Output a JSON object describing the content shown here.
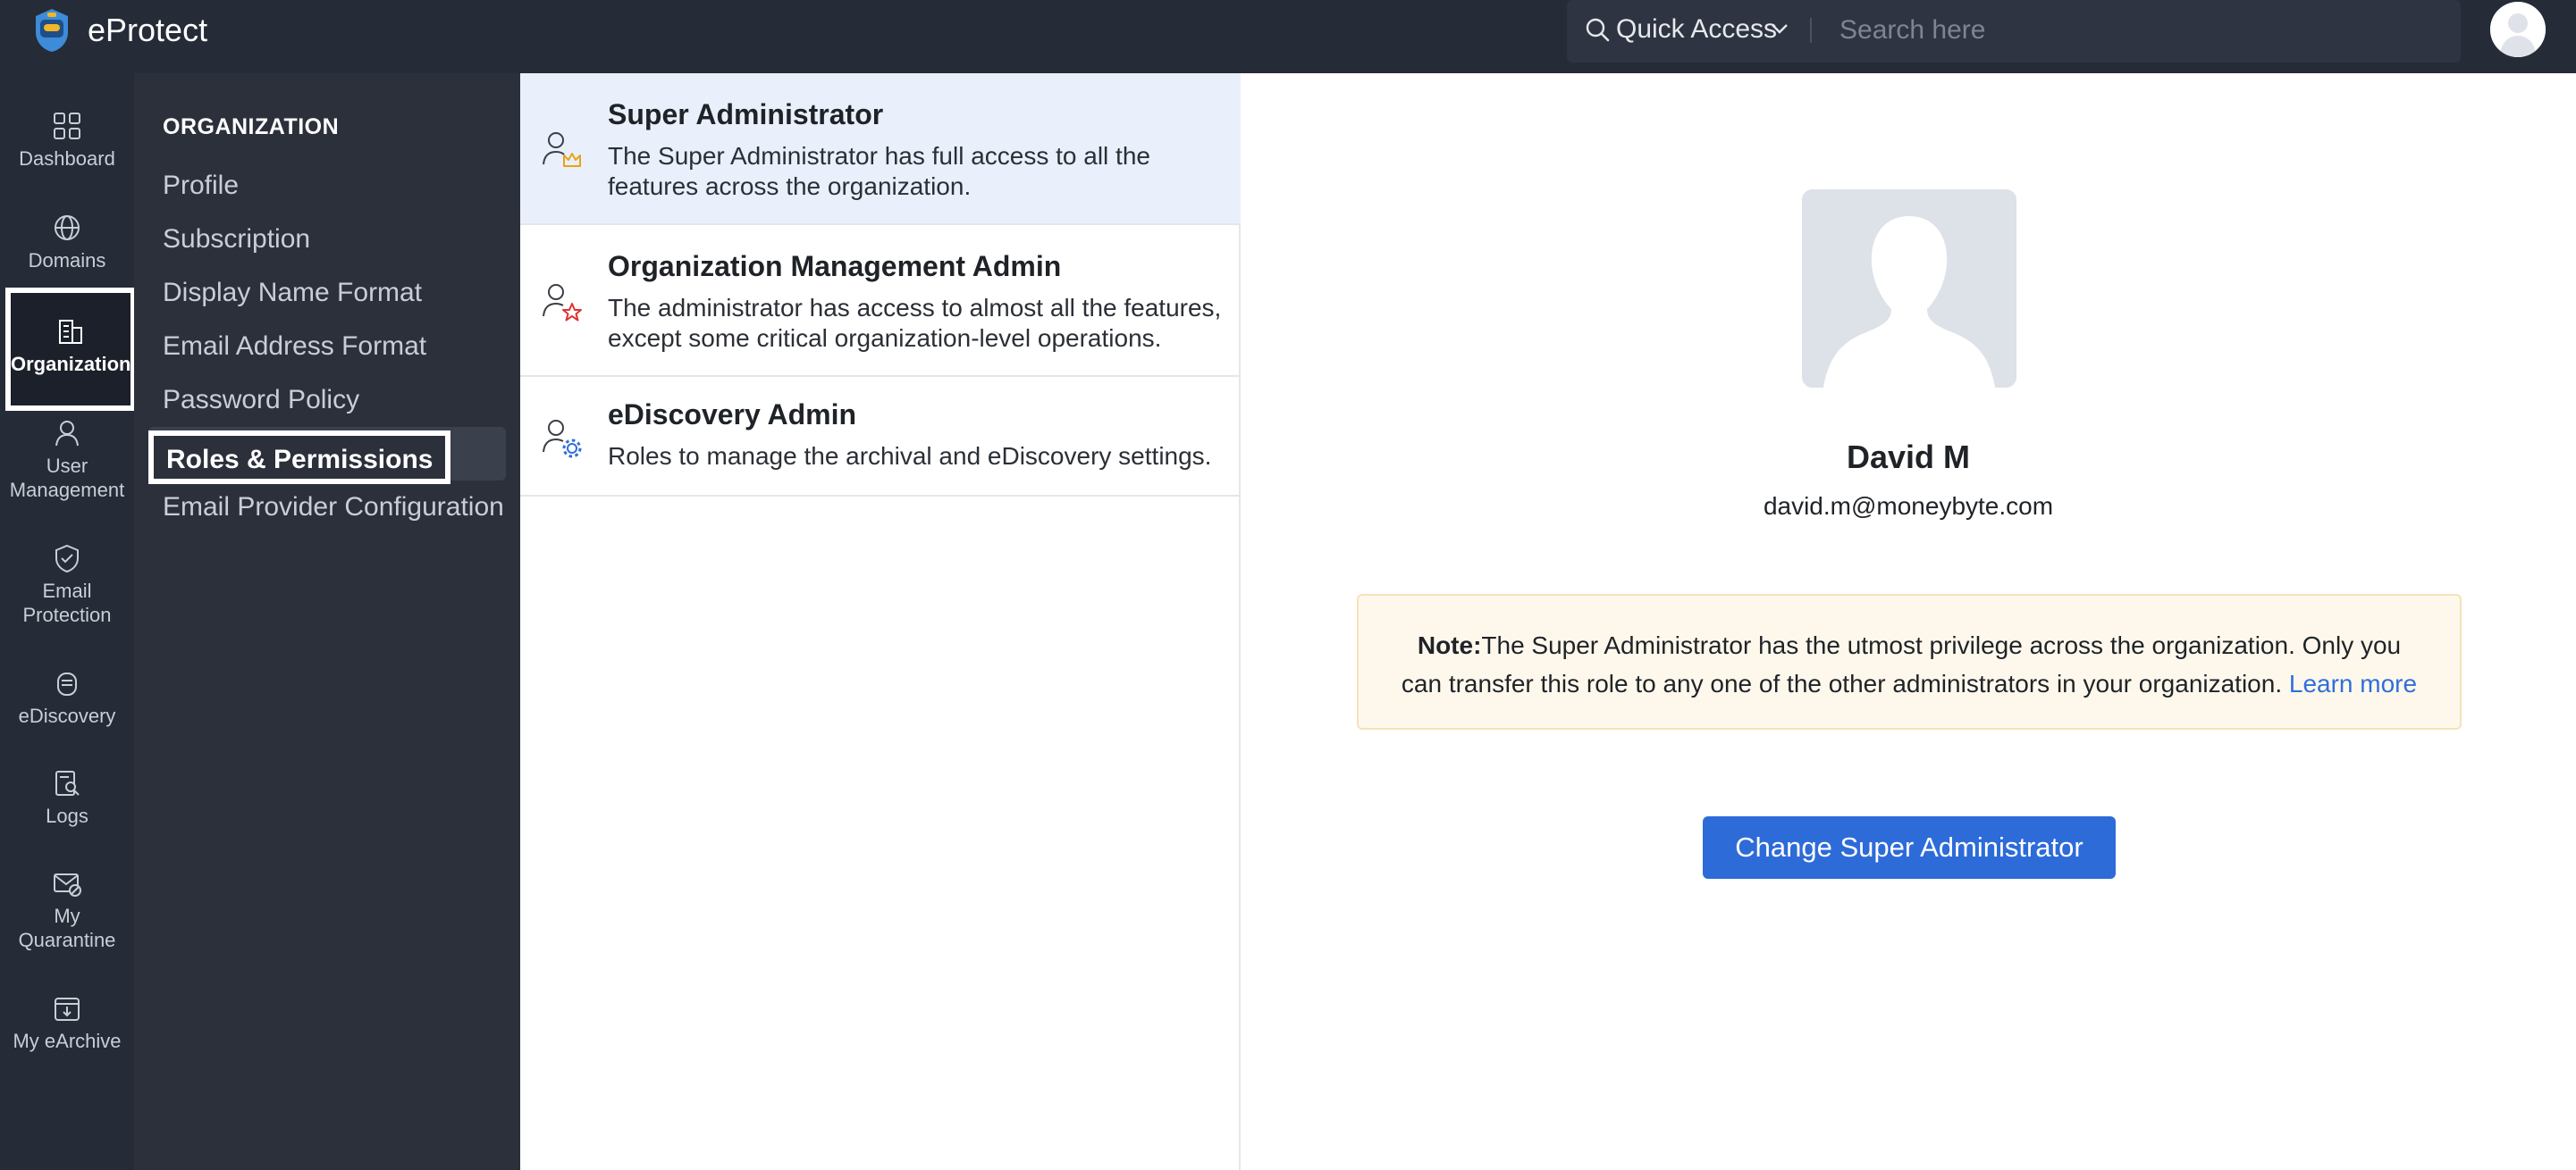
{
  "app": {
    "name": "eProtect"
  },
  "topbar": {
    "quick_access_label": "Quick Access",
    "search_placeholder": "Search here"
  },
  "rail": {
    "items": [
      {
        "label": "Dashboard",
        "icon": "dashboard-icon"
      },
      {
        "label": "Domains",
        "icon": "globe-icon"
      },
      {
        "label": "Organization",
        "icon": "building-icon",
        "active": true
      },
      {
        "label": "User Management",
        "line1": "User",
        "line2": "Management",
        "icon": "user-icon"
      },
      {
        "label": "Email Protection",
        "line1": "Email",
        "line2": "Protection",
        "icon": "shield-icon"
      },
      {
        "label": "eDiscovery",
        "icon": "ediscovery-icon"
      },
      {
        "label": "Logs",
        "icon": "logs-icon"
      },
      {
        "label": "My Quarantine",
        "line1": "My",
        "line2": "Quarantine",
        "icon": "quarantine-icon"
      },
      {
        "label": "My eArchive",
        "icon": "archive-icon"
      }
    ]
  },
  "orgmenu": {
    "heading": "ORGANIZATION",
    "items": [
      {
        "label": "Profile"
      },
      {
        "label": "Subscription"
      },
      {
        "label": "Display Name Format"
      },
      {
        "label": "Email Address Format"
      },
      {
        "label": "Password Policy"
      },
      {
        "label": "Roles & Permissions",
        "active": true
      },
      {
        "label": "Email Provider Configuration"
      }
    ]
  },
  "roles": [
    {
      "title": "Super Administrator",
      "description": "The Super Administrator has full access to all the features across the organization.",
      "icon": "user-crown-icon",
      "selected": true
    },
    {
      "title": "Organization Management Admin",
      "description": "The administrator has access to almost all the features, except some critical organization-level operations.",
      "icon": "user-star-icon"
    },
    {
      "title": "eDiscovery Admin",
      "description": "Roles to manage the archival and eDiscovery settings.",
      "icon": "user-gear-icon"
    }
  ],
  "detail": {
    "name": "David M",
    "email": "david.m@moneybyte.com",
    "note_label": "Note:",
    "note_text": "The Super Administrator has the utmost privilege across the organization. Only you can transfer this role to any one of the other administrators in your organization. ",
    "learn_more": "Learn more",
    "change_button": "Change Super Administrator"
  },
  "colors": {
    "topbar": "#252b37",
    "accent": "#2d6bd8",
    "link": "#2f6fdb",
    "selected_row": "#e9f0fb",
    "note_bg": "#fef8ec"
  }
}
